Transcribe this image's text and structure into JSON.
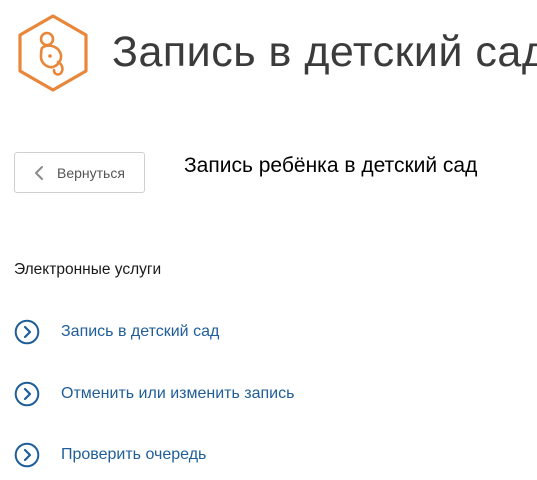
{
  "header": {
    "title": "Запись в детский сад",
    "logo_icon": "pacifier-icon",
    "logo_color": "#e8863a"
  },
  "back_button": {
    "label": "Вернуться",
    "icon": "chevron-left-icon"
  },
  "page": {
    "heading": "Запись ребёнка в детский сад"
  },
  "services": {
    "title": "Электронные услуги",
    "items": [
      {
        "label": "Запись в детский сад",
        "icon": "chevron-right-circle-icon"
      },
      {
        "label": "Отменить или изменить запись",
        "icon": "chevron-right-circle-icon"
      },
      {
        "label": "Проверить очередь",
        "icon": "chevron-right-circle-icon"
      }
    ],
    "link_color": "#1f5e98"
  }
}
